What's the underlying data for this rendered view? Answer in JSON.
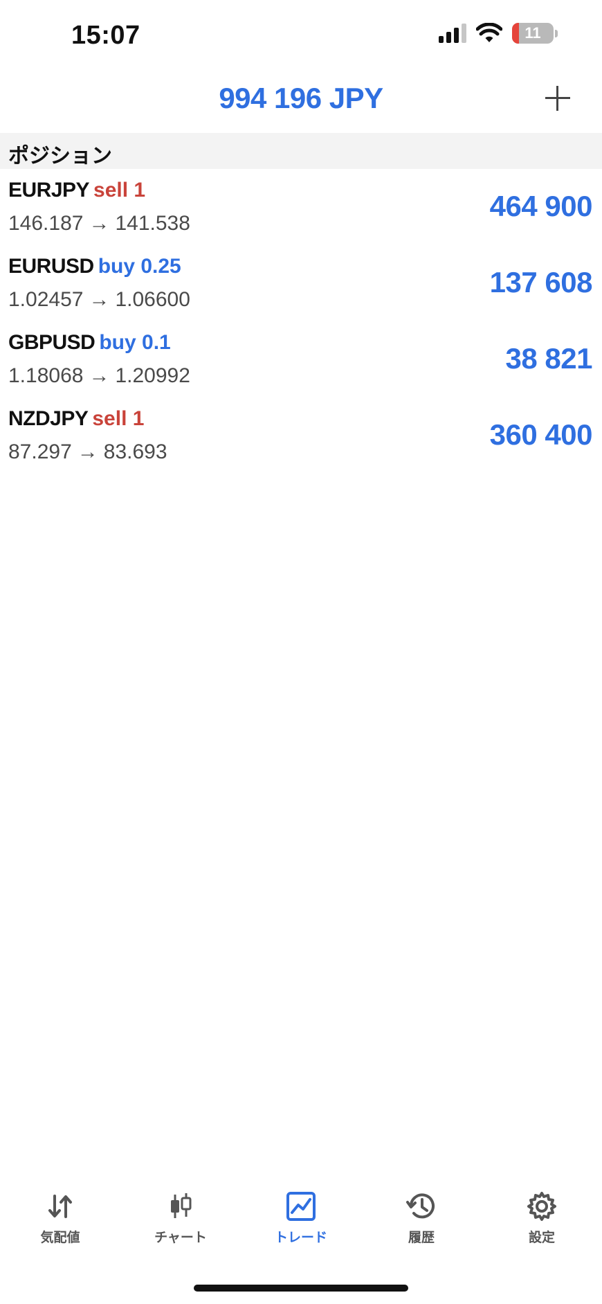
{
  "status_bar": {
    "time": "15:07",
    "battery": "11"
  },
  "header": {
    "balance": "994 196 JPY"
  },
  "section": {
    "title": "ポジション"
  },
  "positions": [
    {
      "symbol": "EURJPY",
      "action": "sell 1",
      "side": "sell",
      "open_price": "146.187",
      "arrow": "→",
      "current_price": "141.538",
      "profit": "464 900"
    },
    {
      "symbol": "EURUSD",
      "action": "buy 0.25",
      "side": "buy",
      "open_price": "1.02457",
      "arrow": "→",
      "current_price": "1.06600",
      "profit": "137 608"
    },
    {
      "symbol": "GBPUSD",
      "action": "buy 0.1",
      "side": "buy",
      "open_price": "1.18068",
      "arrow": "→",
      "current_price": "1.20992",
      "profit": "38 821"
    },
    {
      "symbol": "NZDJPY",
      "action": "sell 1",
      "side": "sell",
      "open_price": "87.297",
      "arrow": "→",
      "current_price": "83.693",
      "profit": "360 400"
    }
  ],
  "tabs": [
    {
      "label": "気配値",
      "icon": "quotes-arrows-icon",
      "active": false
    },
    {
      "label": "チャート",
      "icon": "candlestick-chart-icon",
      "active": false
    },
    {
      "label": "トレード",
      "icon": "trade-chart-icon",
      "active": true
    },
    {
      "label": "履歴",
      "icon": "history-clock-icon",
      "active": false
    },
    {
      "label": "設定",
      "icon": "gear-icon",
      "active": false
    }
  ],
  "colors": {
    "accent": "#2f6fe0",
    "sell": "#c9433a",
    "buy": "#2f6fe0",
    "inactive_tab": "#555555"
  }
}
